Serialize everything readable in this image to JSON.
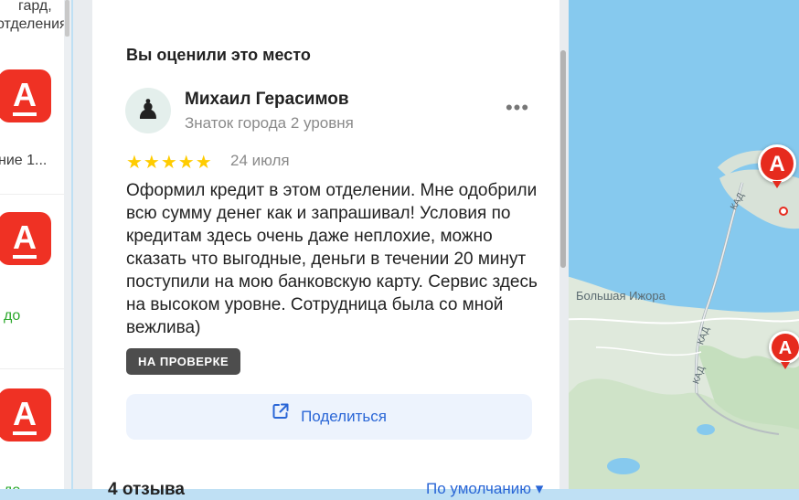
{
  "left_list": {
    "items": [
      {
        "text": "гард,"
      },
      {
        "text": "отделения"
      },
      {
        "text": "ние 1..."
      },
      {
        "text": "до"
      },
      {
        "text": "до"
      }
    ],
    "logo_letter": "А"
  },
  "review": {
    "section_title": "Вы оценили это место",
    "author_name": "Михаил Герасимов",
    "author_level": "Знаток города 2 уровня",
    "more_label": "•••",
    "stars": "★★★★★",
    "rating": 5,
    "date": "24 июля",
    "text": "Оформил кредит в этом отделении. Мне одобрили всю сумму денег как и запрашивал! Условия по кредитам здесь очень даже неплохие, можно сказать что выгодные, деньги в течении 20 минут поступили на мою банковскую карту. Сервис здесь на высоком уровне. Сотрудница была со мной вежлива)",
    "status": "НА ПРОВЕРКЕ",
    "share_label": "Поделиться"
  },
  "reviews_footer": {
    "count": "4 отзыва",
    "sort": "По умолчанию ▾"
  },
  "map": {
    "labels": {
      "town": "Большая Ижора",
      "road1": "КАД",
      "road2": "КАД",
      "road3": "КАД"
    },
    "pin_letter": "А"
  },
  "colors": {
    "brand_red": "#ef3124",
    "link_blue": "#2a66d6",
    "star_yellow": "#ffcc00",
    "water": "#7cc4ec",
    "land": "#dfe9dc"
  }
}
